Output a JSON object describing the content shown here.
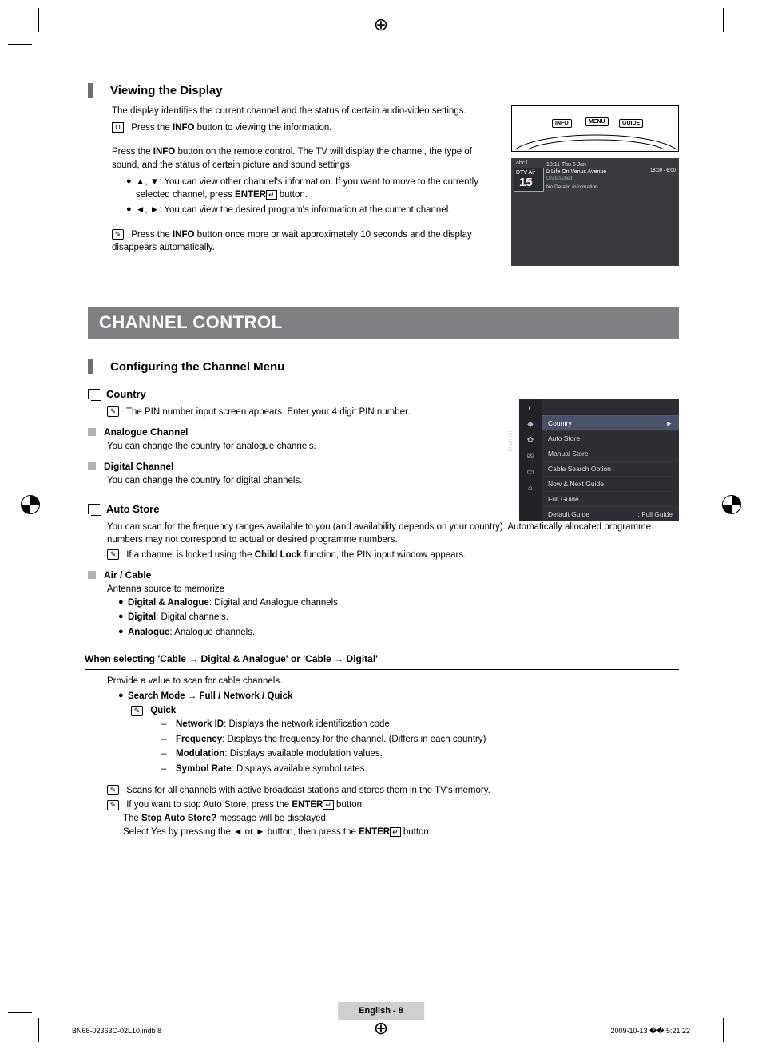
{
  "section1": {
    "title": "Viewing the Display",
    "p1": "The display identifies the current channel and the status of certain audio-video settings.",
    "p2": "Press the INFO button to viewing the information.",
    "p3": "Press the INFO button on the remote control. The TV will display the channel, the type of sound, and the status of certain picture and sound settings.",
    "b1": "▲, ▼: You can view other channel's information. If you want to move to the currently selected channel, press ENTER",
    "b1_tail": " button.",
    "b2": "◄, ►: You can view the desired program's information at the current channel.",
    "note1": "Press the INFO button once more or wait approximately 10 seconds and the display disappears automatically."
  },
  "banner": "CHANNEL CONTROL",
  "section2": {
    "title": "Configuring the Channel Menu",
    "country": {
      "title": "Country",
      "note": "The PIN number input screen appears. Enter your 4 digit PIN number.",
      "analog_t": "Analogue Channel",
      "analog_d": "You can change the country for analogue channels.",
      "digital_t": "Digital Channel",
      "digital_d": "You can change the country for digital channels."
    },
    "auto": {
      "title": "Auto Store",
      "p1": "You can scan for the frequency ranges available to you (and availability depends on your country). Automatically allocated programme numbers may not correspond to actual or desired programme numbers.",
      "note": "If a channel is locked using the Child Lock function, the PIN input window appears.",
      "air_t": "Air / Cable",
      "air_d": "Antenna source to memorize",
      "opt1_b": "Digital & Analogue",
      "opt1_r": ": Digital and Analogue channels.",
      "opt2_b": "Digital",
      "opt2_r": ": Digital channels.",
      "opt3_b": "Analogue",
      "opt3_r": ": Analogue channels."
    },
    "cable": {
      "heading": "When selecting 'Cable → Digital & Analogue' or 'Cable → Digital'",
      "p1": "Provide a value to scan for cable channels.",
      "sm": "Search Mode → Full / Network / Quick",
      "quick": "Quick",
      "d1b": "Network ID",
      "d1r": ": Displays the network identification code.",
      "d2b": "Frequency",
      "d2r": ": Displays the frequency for the channel. (Differs in each country)",
      "d3b": "Modulation",
      "d3r": ": Displays available modulation values.",
      "d4b": "Symbol Rate",
      "d4r": ": Displays available symbol rates.",
      "n1": "Scans for all channels with active broadcast stations and stores them in the TV's memory.",
      "n2a": "If you want to stop Auto Store, press the ENTER",
      "n2b": " button.",
      "n3": "The Stop Auto Store? message will be displayed.",
      "n4a": "Select Yes by pressing the ◄ or ► button, then press the ENTER",
      "n4b": " button."
    }
  },
  "remote": {
    "info": "INFO",
    "menu": "MENU",
    "guide": "GUIDE"
  },
  "tv": {
    "label1": "abc1",
    "label2": "DTV Air",
    "num": "15",
    "time": "18:11 Thu 6 Jan",
    "prog": "Life On Venus Avenue",
    "sub": "Unclassified",
    "range": "18:00 - 6:00",
    "noinfo": "No Detaild Information"
  },
  "menu": {
    "side_label": "Channel",
    "items": [
      "Country",
      "Auto Store",
      "Manual Store",
      "Cable Search Option",
      "Now & Next Guide",
      "Full Guide",
      "Default Guide"
    ],
    "last_value": ": Full Guide",
    "arrow": "►"
  },
  "footer": {
    "center": "English - 8",
    "left": "BN68-02363C-02L10.indb   8",
    "right": "2009-10-13   �� 5:21:22"
  }
}
